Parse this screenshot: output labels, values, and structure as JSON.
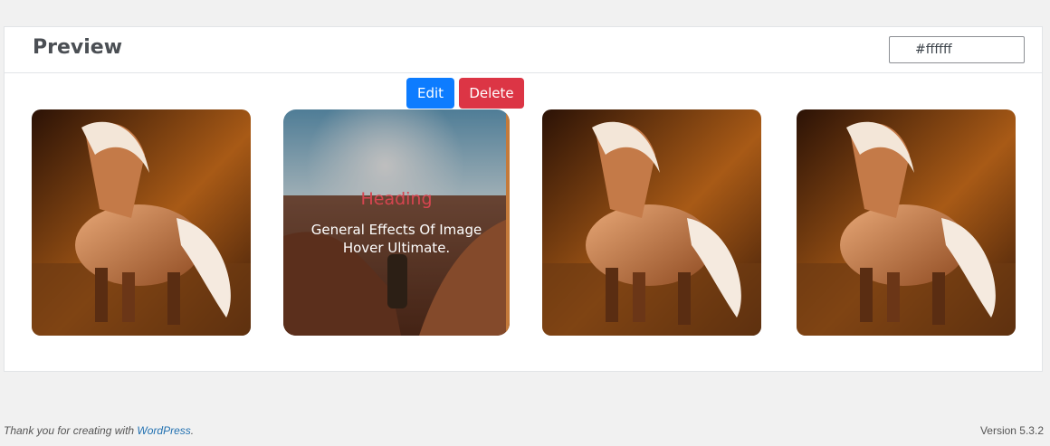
{
  "panel": {
    "title": "Preview",
    "color_value": "#ffffff"
  },
  "actions": {
    "edit_label": "Edit",
    "delete_label": "Delete"
  },
  "cards": [
    {
      "image": "horse-image"
    },
    {
      "image": "canyon-image",
      "heading": "Heading",
      "text": "General Effects Of Image Hover Ultimate."
    },
    {
      "image": "horse-image"
    },
    {
      "image": "horse-image"
    }
  ],
  "footer": {
    "thanks_prefix": "Thank you for creating with ",
    "link": "WordPress",
    "thanks_suffix": ".",
    "version": "Version 5.3.2"
  },
  "colors": {
    "edit": "#0d7cff",
    "delete": "#dc3545",
    "heading": "#d64550"
  }
}
